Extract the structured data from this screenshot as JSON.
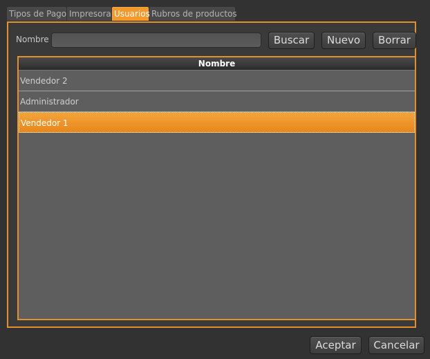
{
  "tabs": [
    {
      "label": "Tipos de Pago",
      "active": false
    },
    {
      "label": "Impresora",
      "active": false
    },
    {
      "label": "Usuarios",
      "active": true
    },
    {
      "label": "Rubros de productos",
      "active": false
    }
  ],
  "search": {
    "label": "Nombre",
    "value": "",
    "placeholder": ""
  },
  "toolbar": {
    "buscar_label": "Buscar",
    "nuevo_label": "Nuevo",
    "borrar_label": "Borrar"
  },
  "table": {
    "columns": [
      "Nombre"
    ],
    "rows": [
      {
        "nombre": "Vendedor 2",
        "selected": false
      },
      {
        "nombre": "Administrador",
        "selected": false
      },
      {
        "nombre": "Vendedor 1",
        "selected": true
      }
    ]
  },
  "footer": {
    "aceptar_label": "Aceptar",
    "cancelar_label": "Cancelar"
  },
  "colors": {
    "accent": "#f39a2a",
    "background": "#323232",
    "selection": "#ea8a21"
  }
}
